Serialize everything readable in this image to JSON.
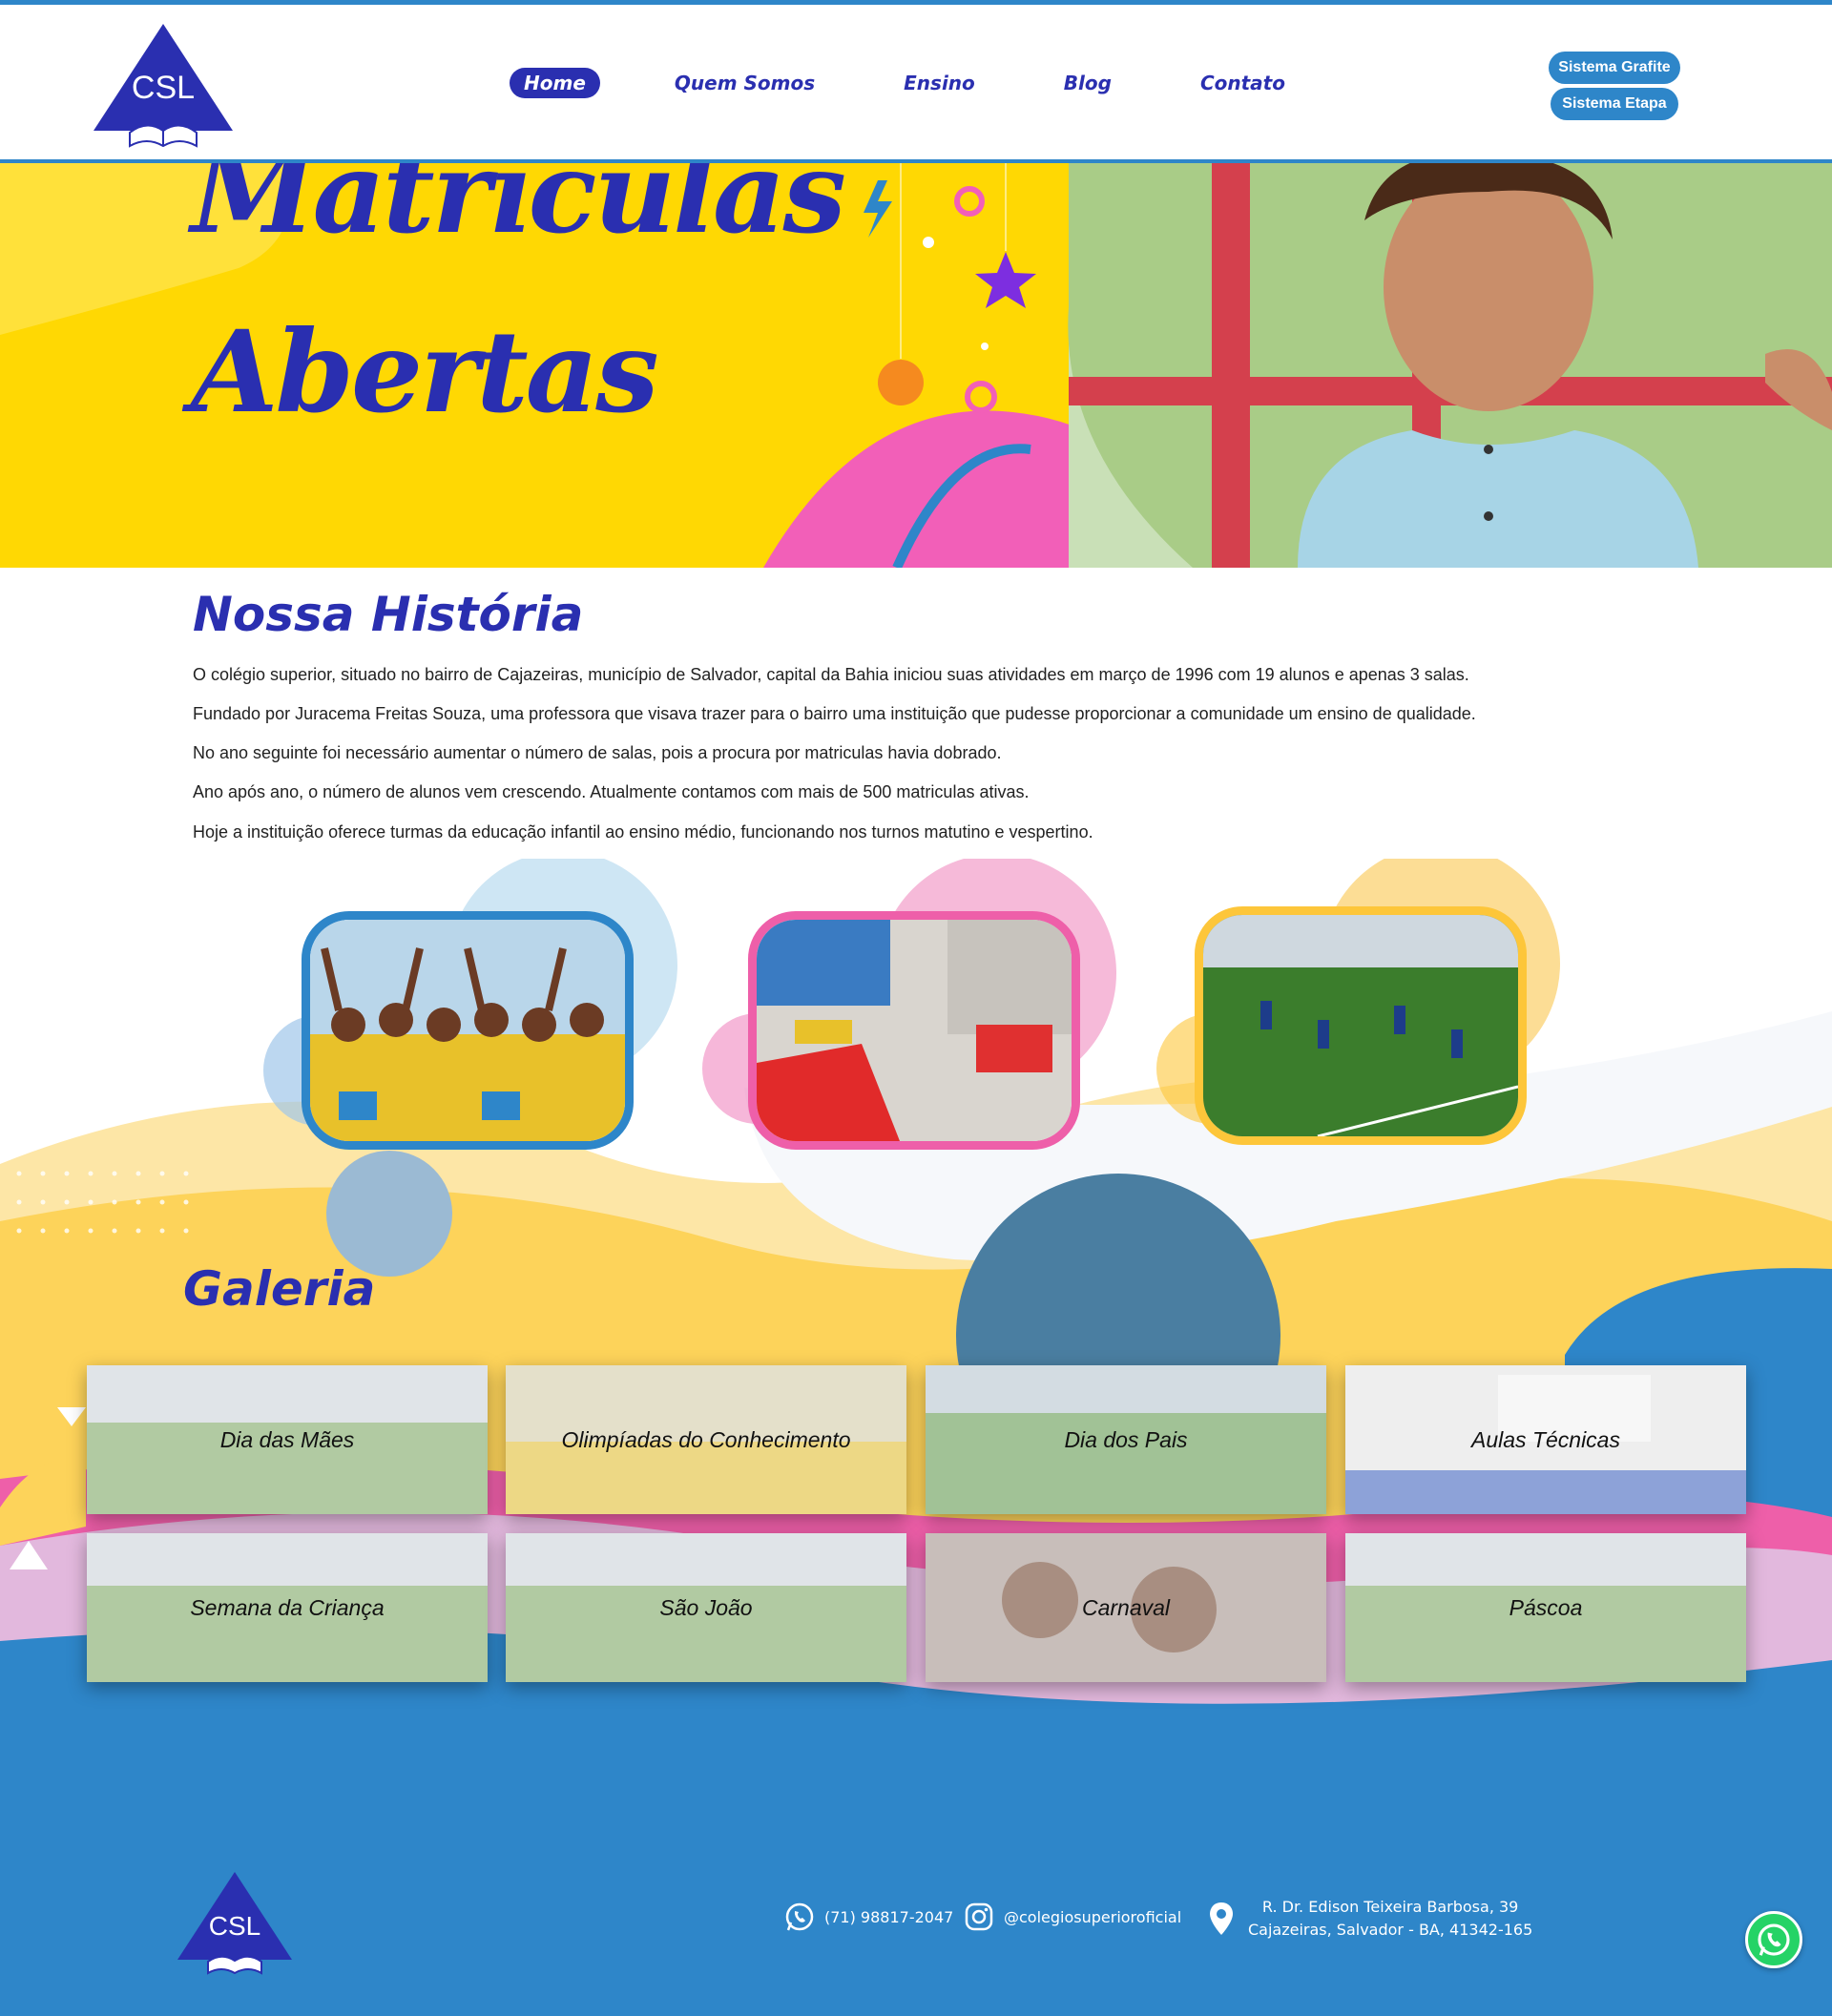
{
  "brand": {
    "logo_text": "CSL"
  },
  "nav": {
    "items": [
      "Home",
      "Quem Somos",
      "Ensino",
      "Blog",
      "Contato"
    ],
    "active": "Home"
  },
  "systems": {
    "grafite": "Sistema Grafite",
    "etapa": "Sistema Etapa"
  },
  "hero": {
    "line1": "Matrículas",
    "line2": "Abertas"
  },
  "history": {
    "title": "Nossa História",
    "paragraphs": [
      "O colégio superior, situado no bairro de Cajazeiras, município de Salvador, capital da Bahia iniciou suas atividades em março de 1996 com 19 alunos e apenas 3 salas.",
      "Fundado por Juracema Freitas Souza, uma professora que visava trazer para o bairro uma instituição que pudesse proporcionar a comunidade um ensino de qualidade.",
      "No ano seguinte foi necessário aumentar o número de salas, pois a procura por matriculas havia dobrado.",
      "Ano após ano, o número de alunos vem crescendo. Atualmente contamos com mais de 500 matriculas ativas.",
      "Hoje a instituição oferece turmas da educação infantil ao ensino médio, funcionando nos turnos matutino e vespertino."
    ]
  },
  "gallery": {
    "title": "Galeria",
    "items": [
      "Dia das Mães",
      "Olimpíadas do Conhecimento",
      "Dia dos Pais",
      "Aulas Técnicas",
      "Semana da Criança",
      "São João",
      "Carnaval",
      "Páscoa"
    ]
  },
  "footer": {
    "phone": "(71) 98817-2047",
    "instagram": "@colegiosuperioroficial",
    "address_line1": "R. Dr. Edison Teixeira Barbosa, 39",
    "address_line2": "Cajazeiras, Salvador - BA, 41342-165"
  },
  "colors": {
    "brand_blue": "#2a2fb0",
    "accent_blue": "#2e86c9",
    "yellow": "#ffd803",
    "pink": "#f25fb8"
  }
}
